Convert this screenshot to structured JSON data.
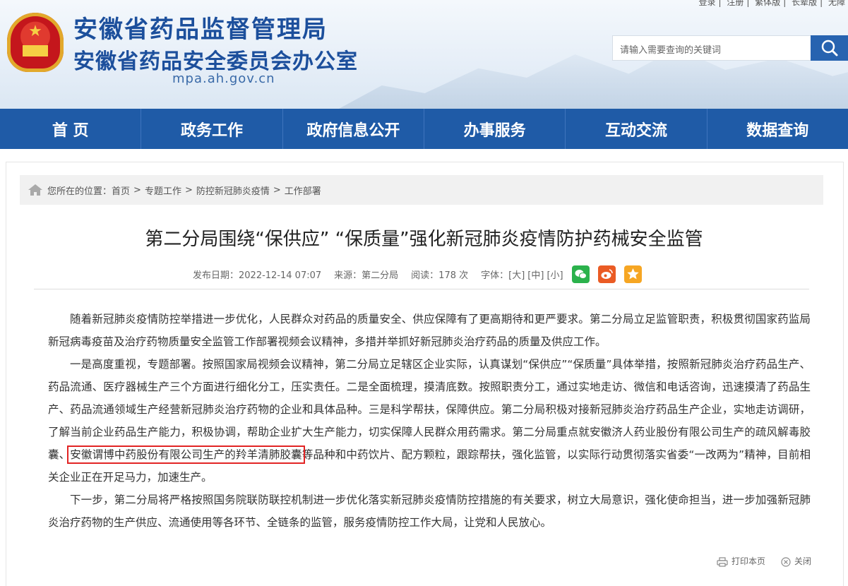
{
  "top_links": [
    "登录",
    "注册",
    "繁体版",
    "长辈版",
    "无障"
  ],
  "header": {
    "title_main": "安徽省药品监督管理局",
    "title_sub": "安徽省药品安全委员会办公室",
    "domain": "mpa.ah.gov.cn"
  },
  "search": {
    "placeholder": "请输入需要查询的关键词"
  },
  "nav": [
    "首 页",
    "政务工作",
    "政府信息公开",
    "办事服务",
    "互动交流",
    "数据查询"
  ],
  "breadcrumb": {
    "prefix": "您所在的位置：",
    "items": [
      "首页",
      "专题工作",
      "防控新冠肺炎疫情",
      "工作部署"
    ],
    "separator": ">"
  },
  "article": {
    "title": "第二分局围绕“保供应” “保质量”强化新冠肺炎疫情防护药械安全监管",
    "meta": {
      "date": "发布日期：2022-12-14 07:07",
      "source": "来源：第二分局",
      "reads": "阅读：178 次",
      "font_label": "字体：",
      "font_large": "[大]",
      "font_medium": "[中]",
      "font_small": "[小]"
    },
    "paragraphs": [
      "随着新冠肺炎疫情防控举措进一步优化，人民群众对药品的质量安全、供应保障有了更高期待和更严要求。第二分局立足监管职责，积极贯彻国家药监局新冠病毒疫苗及治疗药物质量安全监管工作部署视频会议精神，多措并举抓好新冠肺炎治疗药品的质量及供应工作。",
      "一是高度重视，专题部署。按照国家局视频会议精神，第二分局立足辖区企业实际，认真谋划“保供应”“保质量”具体举措，按照新冠肺炎治疗药品生产、药品流通、医疗器械生产三个方面进行细化分工，压实责任。二是全面梳理，摸清底数。按照职责分工，通过实地走访、微信和电话咨询，迅速摸清了药品生产、药品流通领域生产经营新冠肺炎治疗药物的企业和具体品种。三是科学帮扶，保障供应。第二分局积极对接新冠肺炎治疗药品生产企业，实地走访调研，了解当前企业药品生产能力，积极协调，帮助企业扩大生产能力，切实保障人民群众用药需求。第二分局重点就安徽济人药业股份有限公司生产的疏风解毒胶囊、",
      "安徽谓博中药股份有限公司生产的羚羊清肺胶囊",
      "等品种和中药饮片、配方颗粒，跟踪帮扶，强化监管，以实际行动贯彻落实省委“一改两为”精神，目前相关企业正在开足马力，加速生产。",
      "下一步，第二分局将严格按照国务院联防联控机制进一步优化落实新冠肺炎疫情防控措施的有关要求，树立大局意识，强化使命担当，进一步加强新冠肺炎治疗药物的生产供应、流通使用等各环节、全链条的监管，服务疫情防控工作大局，让党和人民放心。"
    ]
  },
  "footer": {
    "print": "打印本页",
    "close": "关闭"
  },
  "colors": {
    "brand_blue": "#1f5ba7",
    "highlight_red": "#e22424",
    "wechat": "#2bb24c",
    "weibo": "#ea5b24",
    "favorite": "#f6a623"
  },
  "icons": [
    "search-icon",
    "home-icon",
    "wechat-icon",
    "weibo-icon",
    "star-icon",
    "printer-icon",
    "close-icon"
  ]
}
